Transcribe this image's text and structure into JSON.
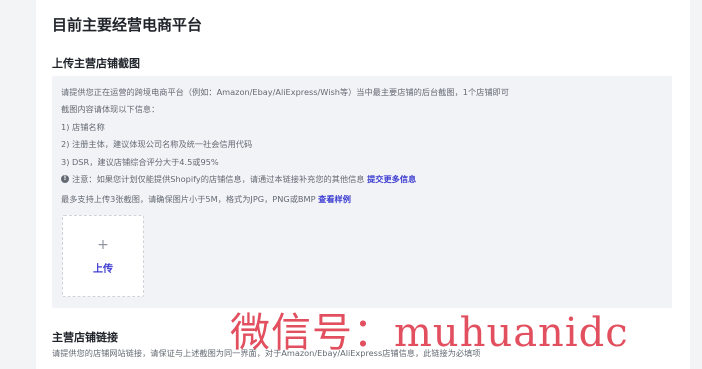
{
  "section": {
    "title": "目前主要经营电商平台"
  },
  "screenshot_upload": {
    "title": "上传主营店铺截图",
    "lines": [
      "请提供您正在运营的跨境电商平台（例如：Amazon/Ebay/AliExpress/Wish等）当中最主要店铺的后台截图，1个店铺即可",
      "截图内容请体现以下信息：",
      "1) 店铺名称",
      "2) 注册主体，建议体现公司名称及统一社会信用代码",
      "3) DSR，建议店铺综合评分大于4.5或95%"
    ],
    "notice_text": "注意：如果您计划仅能提供Shopify的店铺信息，请通过本链接补充您的其他信息",
    "notice_link": "提交更多信息",
    "limit_text": "最多支持上传3张截图，请确保图片小于5M，格式为JPG，PNG或BMP",
    "limit_link": "查看样例",
    "upload_plus": "+",
    "upload_label": "上传"
  },
  "store_link": {
    "title": "主营店铺链接",
    "description": "请提供您的店铺网站链接，请保证与上述截图为同一界面，对于Amazon/Ebay/AliExpress店铺信息，此链接为必填项"
  },
  "watermark": {
    "text": "微信号：muhuanidc"
  },
  "colors": {
    "accent": "#3c3cd1",
    "info_bg": "#f2f3f7",
    "watermark": "#dc283c"
  }
}
